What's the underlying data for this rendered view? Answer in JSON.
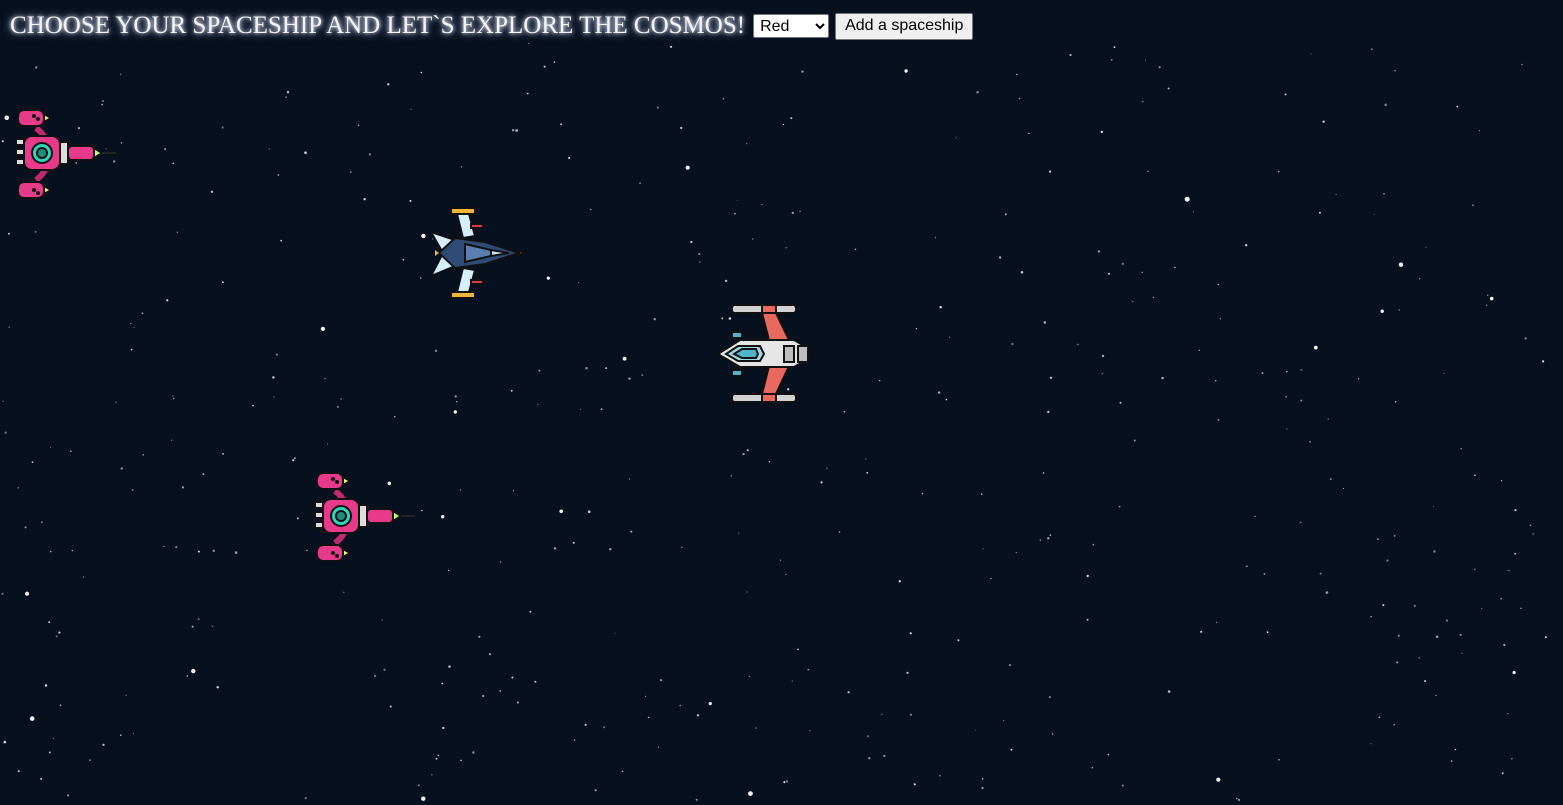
{
  "header": {
    "title": "CHOOSE YOUR SPACESHIP AND LET`S EXPLORE THE COSMOS!",
    "color_select": {
      "selected": "Red",
      "options": [
        "Red"
      ]
    },
    "add_button_label": "Add a spaceship"
  },
  "colors": {
    "background": "#06101f",
    "pink_ship": "#e83a8a",
    "blue_ship": "#2f4c78",
    "gray_ship": "#d3d3d3"
  },
  "ships": [
    {
      "kind": "pink-ship",
      "icon": "pink-spaceship-icon"
    },
    {
      "kind": "blue-ship",
      "icon": "blue-spaceship-icon"
    },
    {
      "kind": "gray-ship",
      "icon": "gray-spaceship-icon"
    },
    {
      "kind": "pink-ship",
      "icon": "pink-spaceship-icon"
    }
  ]
}
